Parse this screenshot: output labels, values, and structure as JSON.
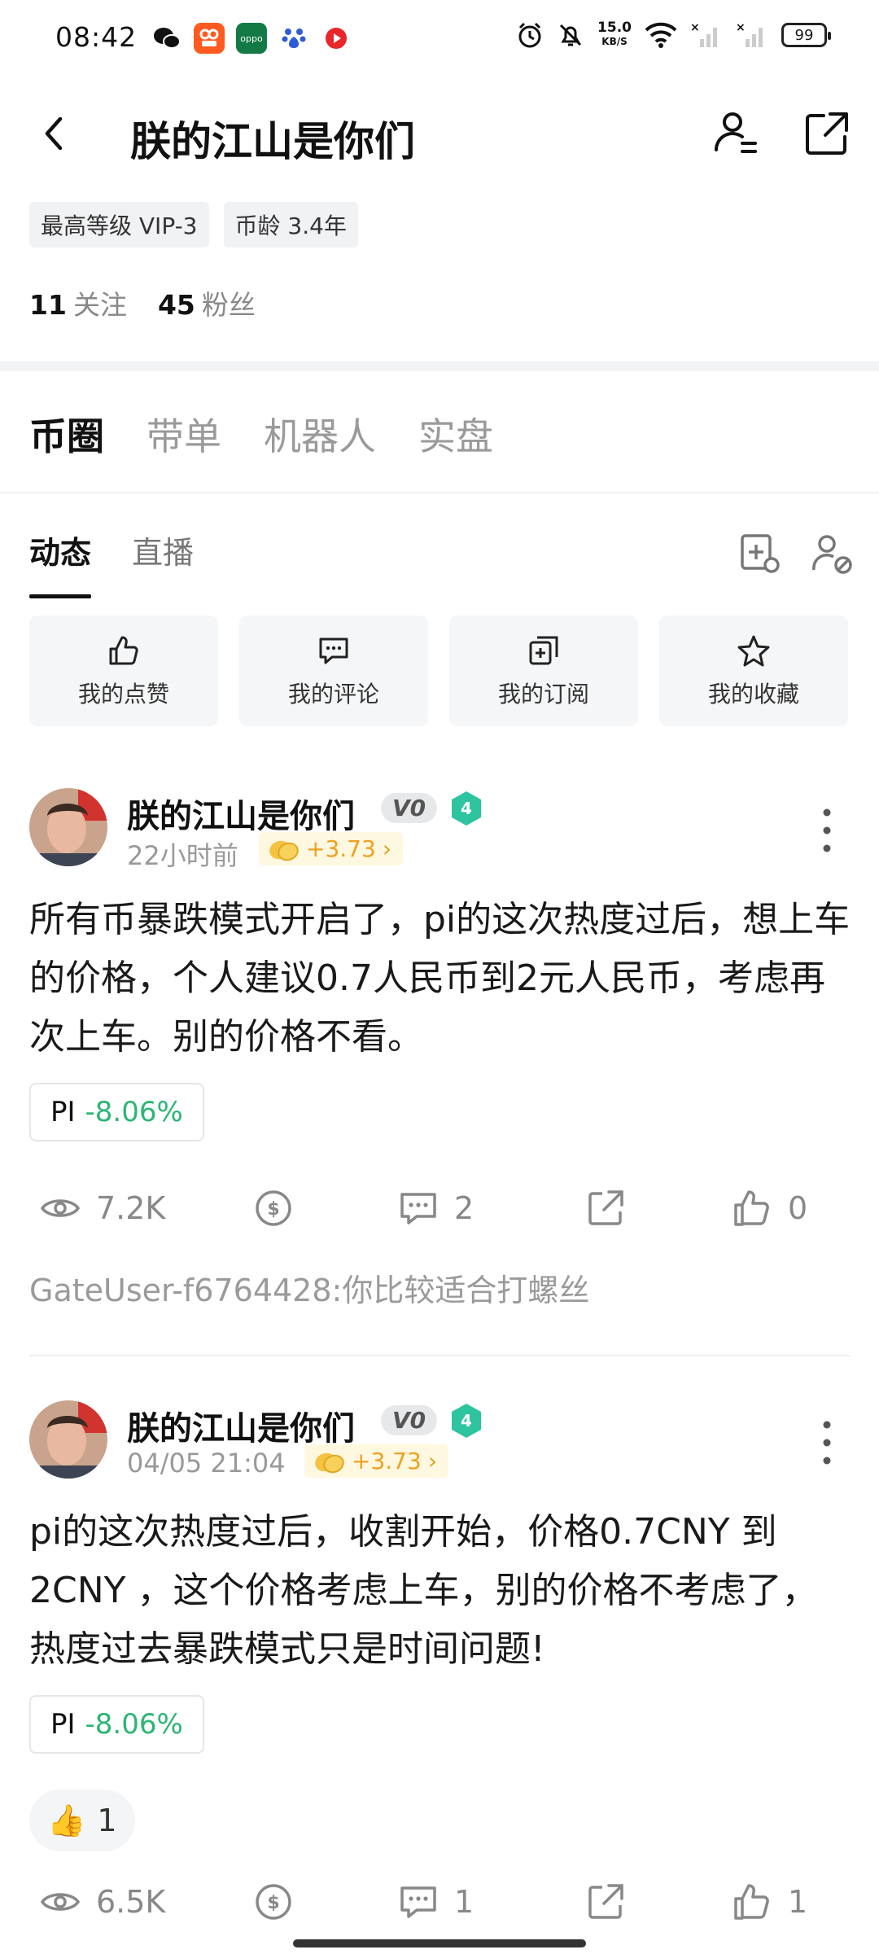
{
  "status_bar": {
    "time": "08:42",
    "speed_value": "15.0",
    "speed_unit": "KB/S",
    "battery": "99"
  },
  "header": {
    "title": "朕的江山是你们"
  },
  "profile": {
    "tags": [
      "最高等级 VIP-3",
      "币龄 3.4年"
    ],
    "following_count": "11",
    "following_label": "关注",
    "followers_count": "45",
    "followers_label": "粉丝"
  },
  "main_tabs": [
    "币圈",
    "带单",
    "机器人",
    "实盘"
  ],
  "sub_tabs": [
    "动态",
    "直播"
  ],
  "quick_actions": [
    {
      "label": "我的点赞",
      "icon": "thumbs-up-icon"
    },
    {
      "label": "我的评论",
      "icon": "comment-icon"
    },
    {
      "label": "我的订阅",
      "icon": "subscribe-icon"
    },
    {
      "label": "我的收藏",
      "icon": "star-icon"
    }
  ],
  "posts": [
    {
      "author": "朕的江山是你们",
      "vip": "V0",
      "level": "4",
      "time": "22小时前",
      "coin_reward": "+3.73",
      "text": "所有币暴跌模式开启了，pi的这次热度过后，想上车的价格，个人建议0.7人民币到2元人民币，考虑再次上车。别的价格不看。",
      "coin_symbol": "PI",
      "coin_change": "-8.06%",
      "views": "7.2K",
      "comments": "2",
      "likes": "0",
      "comment_preview": "GateUser-f6764428:你比较适合打螺丝"
    },
    {
      "author": "朕的江山是你们",
      "vip": "V0",
      "level": "4",
      "time": "04/05 21:04",
      "coin_reward": "+3.73",
      "text": "pi的这次热度过后，收割开始，价格0.7CNY 到 2CNY ，这个价格考虑上车，别的价格不考虑了，热度过去暴跌模式只是时间问题!",
      "coin_symbol": "PI",
      "coin_change": "-8.06%",
      "reaction_emoji": "👍",
      "reaction_count": "1",
      "views": "6.5K",
      "comments": "1",
      "likes": "1"
    }
  ],
  "colors": {
    "accent_green": "#2bb673",
    "coin_orange": "#f0a020",
    "level_teal": "#2ec4a0"
  }
}
